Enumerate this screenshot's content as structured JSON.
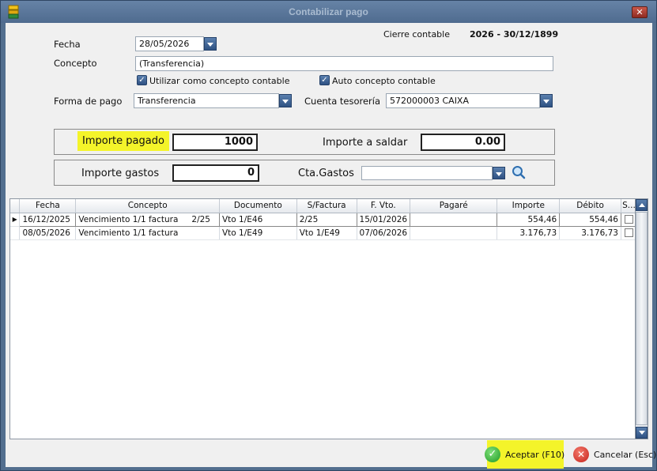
{
  "window": {
    "title": "Contabilizar pago",
    "close_label": "✕"
  },
  "header": {
    "cierre_label": "Cierre contable",
    "cierre_value": "2026 - 30/12/1899"
  },
  "form": {
    "fecha_label": "Fecha",
    "fecha_value": "28/05/2026",
    "concepto_label": "Concepto",
    "concepto_value": "(Transferencia)",
    "utilizar_label": "Utilizar como concepto contable",
    "utilizar_checked": true,
    "auto_label": "Auto concepto contable",
    "auto_checked": true,
    "forma_label": "Forma de pago",
    "forma_value": "Transferencia",
    "cuenta_label": "Cuenta tesorería",
    "cuenta_value": "572000003 CAIXA"
  },
  "importes": {
    "pagado_label": "Importe pagado",
    "pagado_value": "1000",
    "saldar_label": "Importe a saldar",
    "saldar_value": "0.00",
    "gastos_label": "Importe gastos",
    "gastos_value": "0",
    "cta_gastos_label": "Cta.Gastos",
    "cta_gastos_value": ""
  },
  "grid": {
    "columns": [
      "Fecha",
      "Concepto",
      "Documento",
      "S/Factura",
      "F. Vto.",
      "Pagaré",
      "Importe",
      "Débito",
      "S..."
    ],
    "rows": [
      {
        "fecha": "16/12/2025",
        "concepto": "Vencimiento 1/1 factura",
        "concepto_ref": "2/25",
        "documento": "Vto 1/E46",
        "sfactura": "2/25",
        "fvto": "15/01/2026",
        "pagare": "",
        "importe": "554,46",
        "debito": "554,46",
        "selected": true
      },
      {
        "fecha": "08/05/2026",
        "concepto": "Vencimiento 1/1 factura",
        "concepto_ref": "",
        "documento": "Vto 1/E49",
        "sfactura": "Vto 1/E49",
        "fvto": "07/06/2026",
        "pagare": "",
        "importe": "3.176,73",
        "debito": "3.176,73",
        "selected": false
      }
    ]
  },
  "footer": {
    "accept_label": "Aceptar (F10)",
    "cancel_label": "Cancelar (Esc)"
  },
  "colors": {
    "highlight": "#f4f42a",
    "accent": "#2f5283",
    "titlebar": "#536f8f"
  }
}
